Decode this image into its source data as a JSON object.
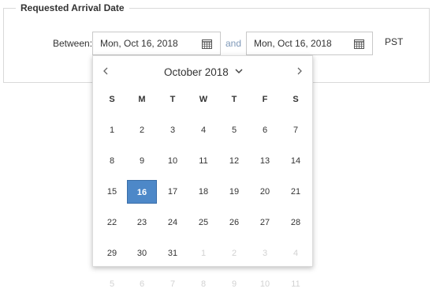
{
  "legend": "Requested Arrival Date",
  "between_label": "Between:",
  "and_label": "and",
  "timezone": "PST",
  "start_date": {
    "value": "Mon, Oct 16, 2018",
    "icon": "calendar-icon"
  },
  "end_date": {
    "value": "Mon, Oct 16, 2018",
    "icon": "calendar-icon"
  },
  "calendar": {
    "month_title": "October 2018",
    "prev_icon": "chevron-left-icon",
    "next_icon": "chevron-right-icon",
    "dropdown_icon": "chevron-down-icon",
    "weekdays": [
      "S",
      "M",
      "T",
      "W",
      "T",
      "F",
      "S"
    ],
    "weeks": [
      [
        "1",
        "2",
        "3",
        "4",
        "5",
        "6",
        "7"
      ],
      [
        "8",
        "9",
        "10",
        "11",
        "12",
        "13",
        "14"
      ],
      [
        "15",
        "16",
        "17",
        "18",
        "19",
        "20",
        "21"
      ],
      [
        "22",
        "23",
        "24",
        "25",
        "26",
        "27",
        "28"
      ],
      [
        "29",
        "30",
        "31",
        "1",
        "2",
        "3",
        "4"
      ],
      [
        "5",
        "6",
        "7",
        "8",
        "9",
        "10",
        "11"
      ]
    ],
    "selected_day": "16",
    "accent_color": "#4d88c8"
  }
}
